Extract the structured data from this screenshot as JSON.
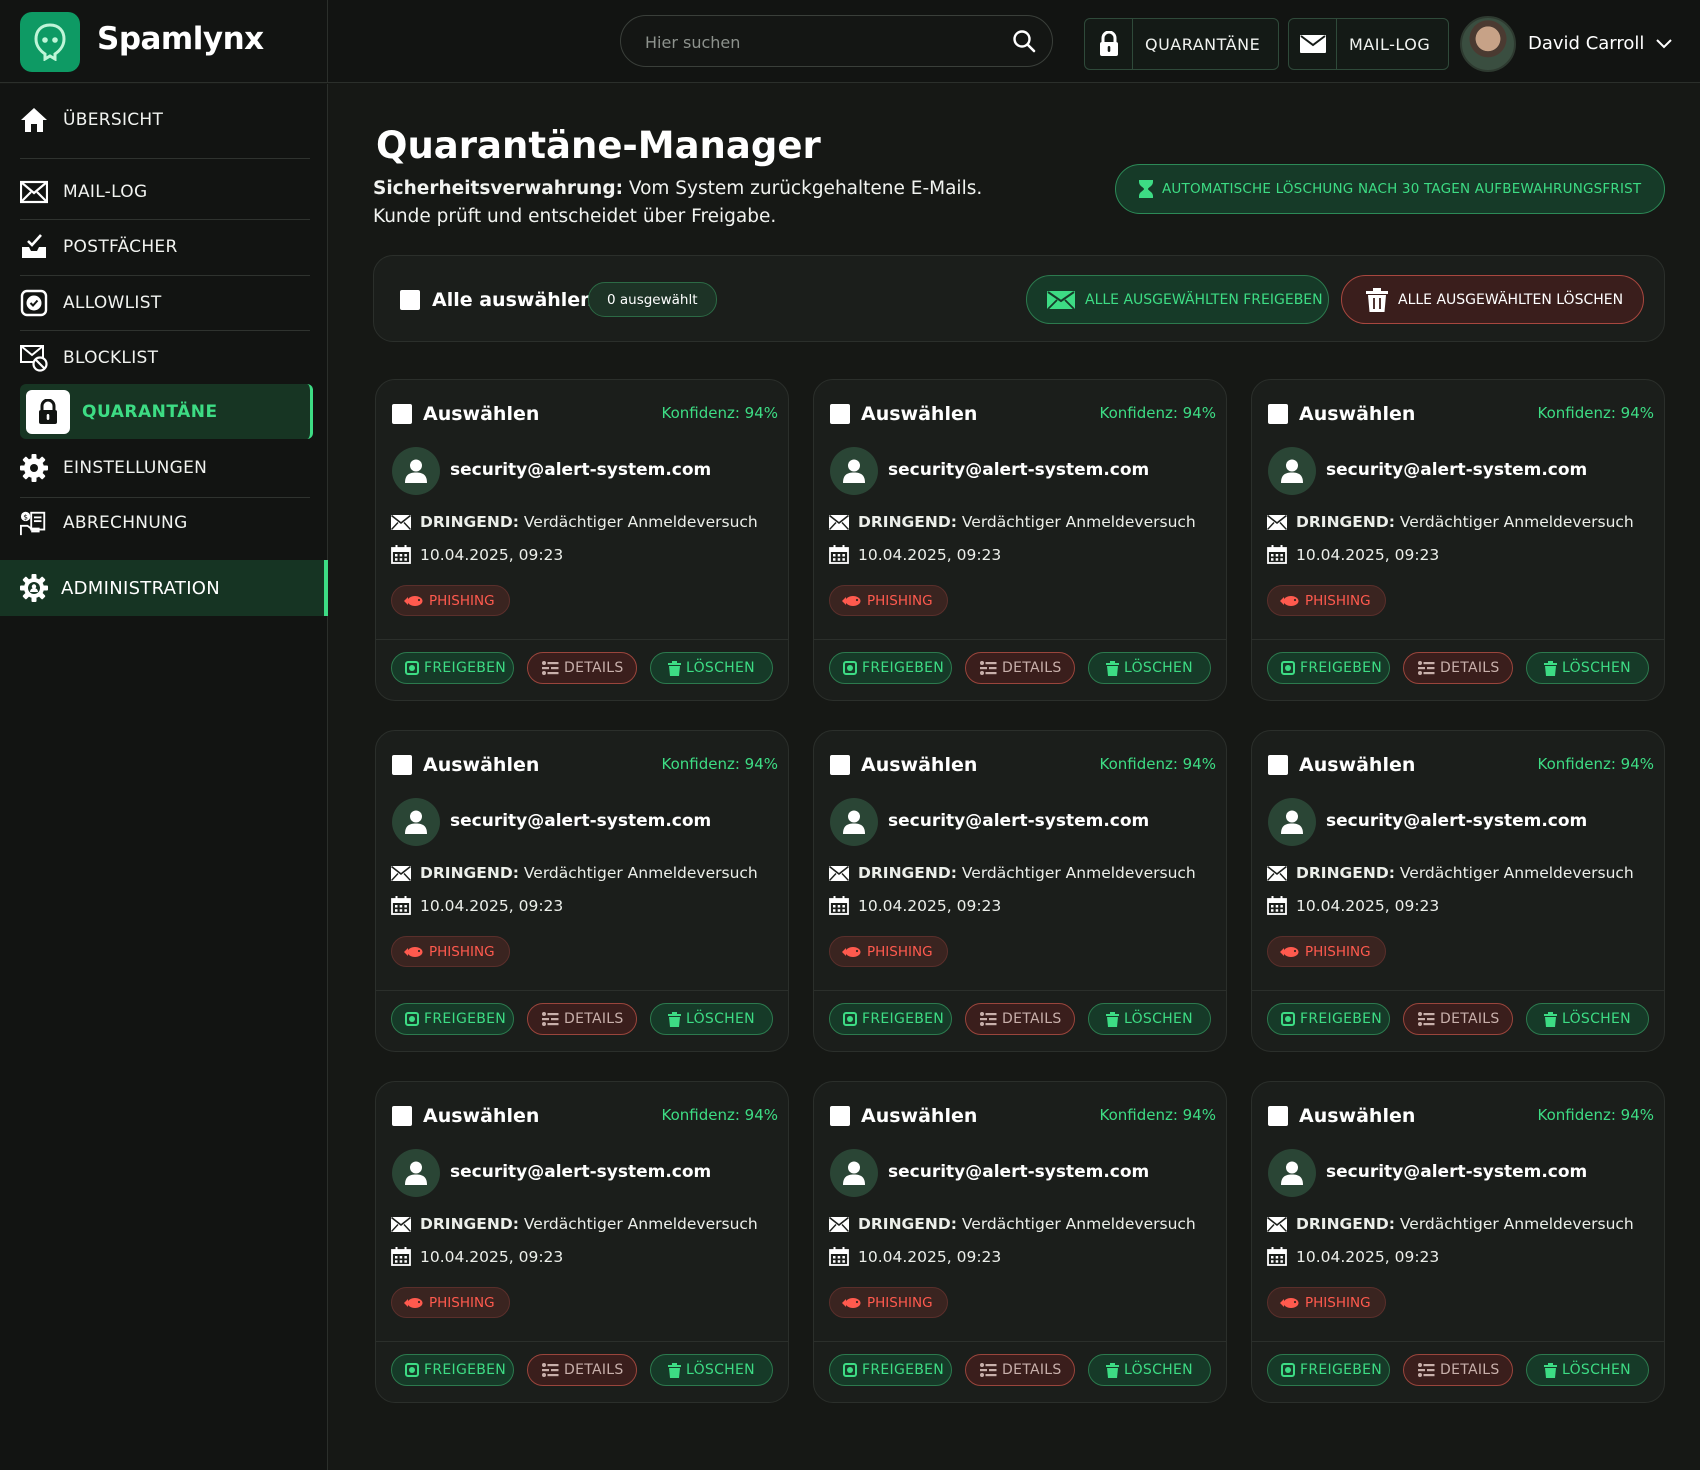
{
  "app": {
    "name": "Spamlynx",
    "brand_color": "#0e9a64",
    "accent_color": "#3ddc84",
    "danger_color": "#ff5a4e"
  },
  "header": {
    "search_placeholder": "Hier suchen",
    "quarantine_label": "QUARANTÄNE",
    "maillog_label": "MAIL-LOG",
    "user_name": "David Carroll"
  },
  "sidebar": {
    "items": [
      {
        "label": "ÜBERSICHT",
        "icon": "home-icon"
      },
      {
        "label": "MAIL-LOG",
        "icon": "mail-log-icon"
      },
      {
        "label": "POSTFÄCHER",
        "icon": "inbox-icon"
      },
      {
        "label": "ALLOWLIST",
        "icon": "allowlist-check-icon"
      },
      {
        "label": "BLOCKLIST",
        "icon": "blocklist-icon"
      },
      {
        "label": "QUARANTÄNE",
        "icon": "lock-icon",
        "active": true
      },
      {
        "label": "EINSTELLUNGEN",
        "icon": "gear-icon"
      },
      {
        "label": "ABRECHNUNG",
        "icon": "billing-icon"
      }
    ],
    "admin_label": "ADMINISTRATION"
  },
  "main": {
    "title": "Quarantäne-Manager",
    "subtitle_bold": "Sicherheitsverwahrung:",
    "subtitle_text": "Vom System zurückgehaltene E-Mails. Kunde prüft und entscheidet über Freigabe.",
    "retention_label": "AUTOMATISCHE LÖSCHUNG NACH 30 TAGEN AUFBEWAHRUNGSFRIST"
  },
  "toolbar": {
    "select_all_label": "Alle auswählen",
    "selected_count": "0 ausgewählt",
    "release_all_label": "ALLE AUSGEWÄHLTEN FREIGEBEN",
    "delete_all_label": "ALLE AUSGEWÄHLTEN LÖSCHEN"
  },
  "cards": [
    {
      "select_label": "Auswählen",
      "confidence": "Konfidenz: 94%",
      "sender": "security@alert-system.com",
      "subject_prefix": "DRINGEND:",
      "subject": "Verdächtiger Anmeldeversuch",
      "date": "10.04.2025, 09:23",
      "tag": "PHISHING",
      "release_label": "FREIGEBEN",
      "details_label": "DETAILS",
      "delete_label": "LÖSCHEN"
    },
    {
      "select_label": "Auswählen",
      "confidence": "Konfidenz: 94%",
      "sender": "security@alert-system.com",
      "subject_prefix": "DRINGEND:",
      "subject": "Verdächtiger Anmeldeversuch",
      "date": "10.04.2025, 09:23",
      "tag": "PHISHING",
      "release_label": "FREIGEBEN",
      "details_label": "DETAILS",
      "delete_label": "LÖSCHEN"
    },
    {
      "select_label": "Auswählen",
      "confidence": "Konfidenz: 94%",
      "sender": "security@alert-system.com",
      "subject_prefix": "DRINGEND:",
      "subject": "Verdächtiger Anmeldeversuch",
      "date": "10.04.2025, 09:23",
      "tag": "PHISHING",
      "release_label": "FREIGEBEN",
      "details_label": "DETAILS",
      "delete_label": "LÖSCHEN"
    },
    {
      "select_label": "Auswählen",
      "confidence": "Konfidenz: 94%",
      "sender": "security@alert-system.com",
      "subject_prefix": "DRINGEND:",
      "subject": "Verdächtiger Anmeldeversuch",
      "date": "10.04.2025, 09:23",
      "tag": "PHISHING",
      "release_label": "FREIGEBEN",
      "details_label": "DETAILS",
      "delete_label": "LÖSCHEN"
    },
    {
      "select_label": "Auswählen",
      "confidence": "Konfidenz: 94%",
      "sender": "security@alert-system.com",
      "subject_prefix": "DRINGEND:",
      "subject": "Verdächtiger Anmeldeversuch",
      "date": "10.04.2025, 09:23",
      "tag": "PHISHING",
      "release_label": "FREIGEBEN",
      "details_label": "DETAILS",
      "delete_label": "LÖSCHEN"
    },
    {
      "select_label": "Auswählen",
      "confidence": "Konfidenz: 94%",
      "sender": "security@alert-system.com",
      "subject_prefix": "DRINGEND:",
      "subject": "Verdächtiger Anmeldeversuch",
      "date": "10.04.2025, 09:23",
      "tag": "PHISHING",
      "release_label": "FREIGEBEN",
      "details_label": "DETAILS",
      "delete_label": "LÖSCHEN"
    },
    {
      "select_label": "Auswählen",
      "confidence": "Konfidenz: 94%",
      "sender": "security@alert-system.com",
      "subject_prefix": "DRINGEND:",
      "subject": "Verdächtiger Anmeldeversuch",
      "date": "10.04.2025, 09:23",
      "tag": "PHISHING",
      "release_label": "FREIGEBEN",
      "details_label": "DETAILS",
      "delete_label": "LÖSCHEN"
    },
    {
      "select_label": "Auswählen",
      "confidence": "Konfidenz: 94%",
      "sender": "security@alert-system.com",
      "subject_prefix": "DRINGEND:",
      "subject": "Verdächtiger Anmeldeversuch",
      "date": "10.04.2025, 09:23",
      "tag": "PHISHING",
      "release_label": "FREIGEBEN",
      "details_label": "DETAILS",
      "delete_label": "LÖSCHEN"
    },
    {
      "select_label": "Auswählen",
      "confidence": "Konfidenz: 94%",
      "sender": "security@alert-system.com",
      "subject_prefix": "DRINGEND:",
      "subject": "Verdächtiger Anmeldeversuch",
      "date": "10.04.2025, 09:23",
      "tag": "PHISHING",
      "release_label": "FREIGEBEN",
      "details_label": "DETAILS",
      "delete_label": "LÖSCHEN"
    }
  ]
}
